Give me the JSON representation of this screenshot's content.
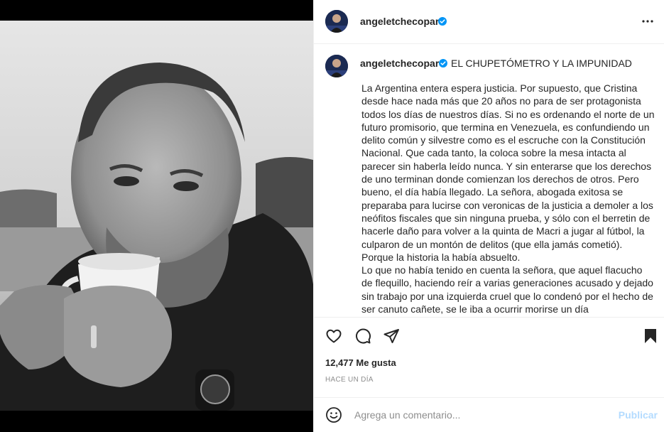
{
  "post": {
    "username": "angeletchecopar",
    "caption_title": "EL CHUPETÓMETRO Y LA IMPUNIDAD",
    "caption_paragraphs": [
      "La Argentina entera espera justicia. Por supuesto, que Cristina desde hace nada más que 20 años no para de ser protagonista todos los días de nuestros días. Si no es ordenando el norte de un futuro promisorio, que termina en Venezuela, es confundiendo un delito común y silvestre como es el escruche con la Constitución Nacional. Que cada tanto, la coloca sobre la mesa intacta al parecer sin haberla leído nunca. Y sin enterarse que los derechos de uno terminan donde comienzan los derechos de otros. Pero bueno, el día había llegado. La señora, abogada exitosa se preparaba para lucirse con veronicas de la justicia a demoler a los neófitos fiscales que sin ninguna prueba, y sólo con el berretin de hacerle daño para volver a la quinta de Macri a jugar al fútbol, la culparon de un montón de delitos (que ella jamás cometió). Porque la historia la había absuelto.",
      "Lo que no había tenido en cuenta la señora, que aquel flacucho de flequillo, haciendo reír a varias generaciones acusado y dejado sin trabajo por una izquierda cruel que lo condenó por el hecho de ser canuto cañete, se le iba a ocurrir morirse un día"
    ],
    "likes": "12,477 Me gusta",
    "time_ago": "HACE UN DÍA",
    "comment_placeholder": "Agrega un comentario...",
    "post_button": "Publicar"
  },
  "icons": {
    "more": "more-options-icon",
    "like": "heart-icon",
    "comment": "comment-icon",
    "share": "share-icon",
    "save": "bookmark-icon",
    "emoji": "emoji-icon",
    "verified": "verified-badge-icon"
  },
  "colors": {
    "verified": "#0095f6",
    "publish_disabled": "#b3dbff",
    "muted_text": "#8e8e8e",
    "divider": "#efefef"
  }
}
